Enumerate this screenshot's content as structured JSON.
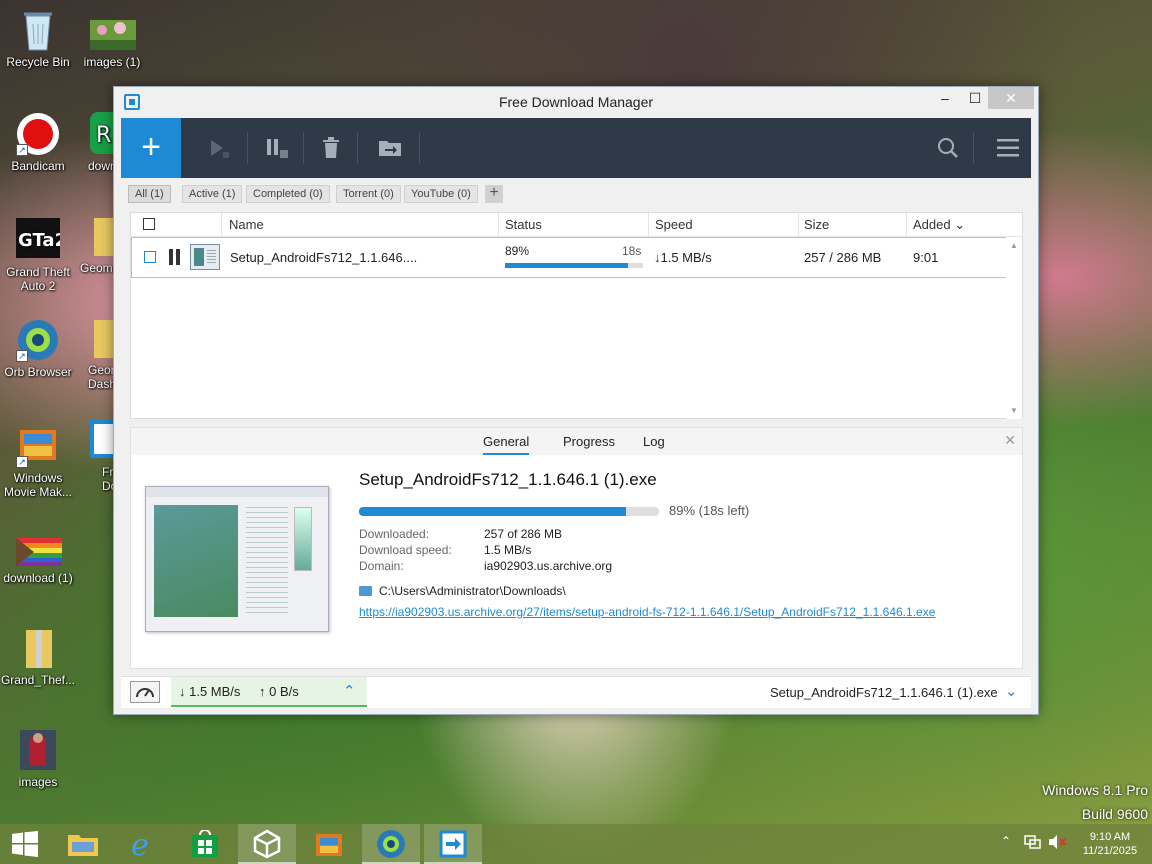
{
  "desktop": {
    "icons": [
      {
        "label": "Recycle Bin"
      },
      {
        "label": "images (1)"
      },
      {
        "label": "Bandicam"
      },
      {
        "label": "down"
      },
      {
        "label": "Grand Theft Auto 2"
      },
      {
        "label": "Geom"
      },
      {
        "label": "Orb Browser"
      },
      {
        "label": "Geom Dash"
      },
      {
        "label": "Windows Movie Mak..."
      },
      {
        "label": "Fr Down"
      },
      {
        "label": "download (1)"
      },
      {
        "label": "Grand_Thef..."
      },
      {
        "label": "images"
      }
    ],
    "watermark_line1": "Windows 8.1 Pro",
    "watermark_line2": "Build 9600"
  },
  "window": {
    "title": "Free Download Manager",
    "min_label": "–",
    "max_label": "☐",
    "close_label": "✕"
  },
  "toolbar": {
    "add_label": "+",
    "start_icon": "play-icon",
    "pause_icon": "pause-all-icon",
    "delete_icon": "trash-icon",
    "move_icon": "move-folder-icon",
    "search_icon": "search-icon",
    "menu_icon": "hamburger-menu-icon"
  },
  "filters": [
    {
      "label": "All (1)"
    },
    {
      "label": "Active (1)"
    },
    {
      "label": "Completed (0)"
    },
    {
      "label": "Torrent (0)"
    },
    {
      "label": "YouTube (0)"
    }
  ],
  "filter_add_label": "+",
  "list": {
    "columns": {
      "name": "Name",
      "status": "Status",
      "speed": "Speed",
      "size": "Size",
      "added": "Added ⌄"
    },
    "rows": [
      {
        "name": "Setup_AndroidFs712_1.1.646....",
        "status_pct": "89%",
        "status_time": "18s",
        "progress": 0.89,
        "speed": "↓1.5 MB/s",
        "size": "257 / 286 MB",
        "added": "9:01"
      }
    ]
  },
  "detail": {
    "tabs": {
      "general": "General",
      "progress": "Progress",
      "log": "Log"
    },
    "close_label": "✕",
    "filename": "Setup_AndroidFs712_1.1.646.1 (1).exe",
    "progress": 0.89,
    "progress_text": "89% (18s left)",
    "downloaded_label": "Downloaded:",
    "downloaded_value": "257 of 286 MB",
    "speed_label": "Download speed:",
    "speed_value": "1.5 MB/s",
    "domain_label": "Domain:",
    "domain_value": "ia902903.us.archive.org",
    "folder": "C:\\Users\\Administrator\\Downloads\\",
    "url": "https://ia902903.us.archive.org/27/items/setup-android-fs-712-1.1.646.1/Setup_AndroidFs712_1.1.646.1.exe"
  },
  "statusbar": {
    "down": "↓ 1.5 MB/s",
    "up": "↑ 0 B/s",
    "expand_label": "⌃",
    "current_file": "Setup_AndroidFs712_1.1.646.1 (1).exe",
    "dropdown_label": "⌄"
  },
  "taskbar": {
    "time": "9:10 AM",
    "date": "11/21/2025"
  },
  "colors": {
    "accent": "#1e8ad6",
    "toolbar_bg": "#2f3a48",
    "speed_green": "#5cb85c"
  }
}
